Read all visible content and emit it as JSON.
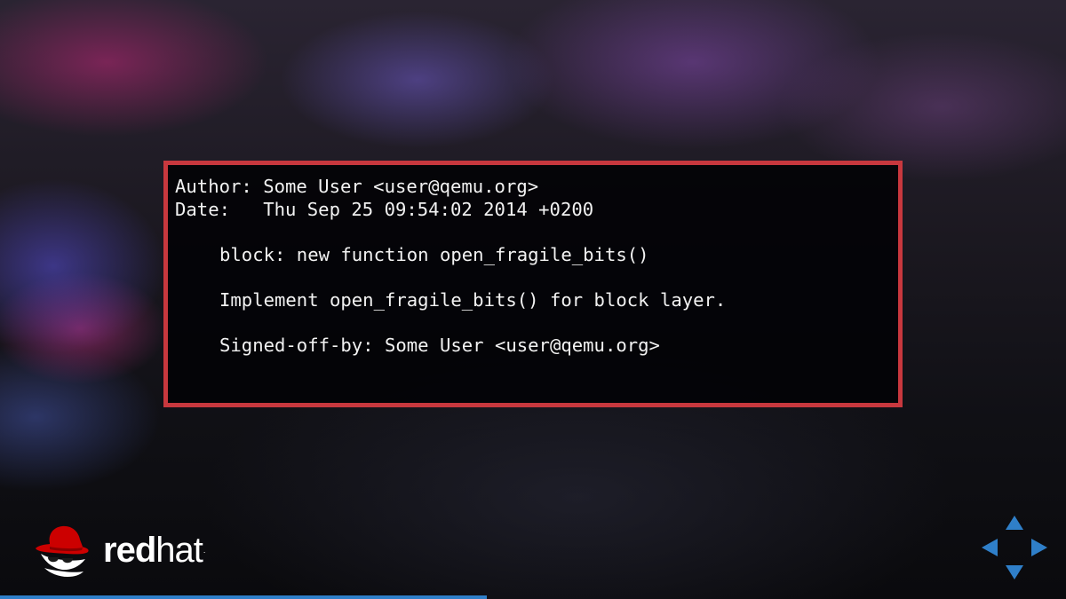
{
  "terminal": {
    "author_line": "Author: Some User <user@qemu.org>",
    "date_line": "Date:   Thu Sep 25 09:54:02 2014 +0200",
    "subject_line": "block: new function open_fragile_bits()",
    "body_line": "Implement open_fragile_bits() for block layer.",
    "signoff_line": "Signed-off-by: Some User <user@qemu.org>"
  },
  "logo": {
    "text_bold": "red",
    "text_light": "hat",
    "trademark": ".",
    "icon": "redhat-shadowman-icon"
  },
  "navigation": {
    "up_icon": "arrow-up-icon",
    "down_icon": "arrow-down-icon",
    "left_icon": "arrow-left-icon",
    "right_icon": "arrow-right-icon"
  },
  "progress": {
    "fraction": 0.457
  },
  "colors": {
    "panel_border": "#c8383e",
    "text": "#f2f2f2",
    "brand_red": "#cc0000",
    "nav_blue": "#2f7fc9"
  }
}
